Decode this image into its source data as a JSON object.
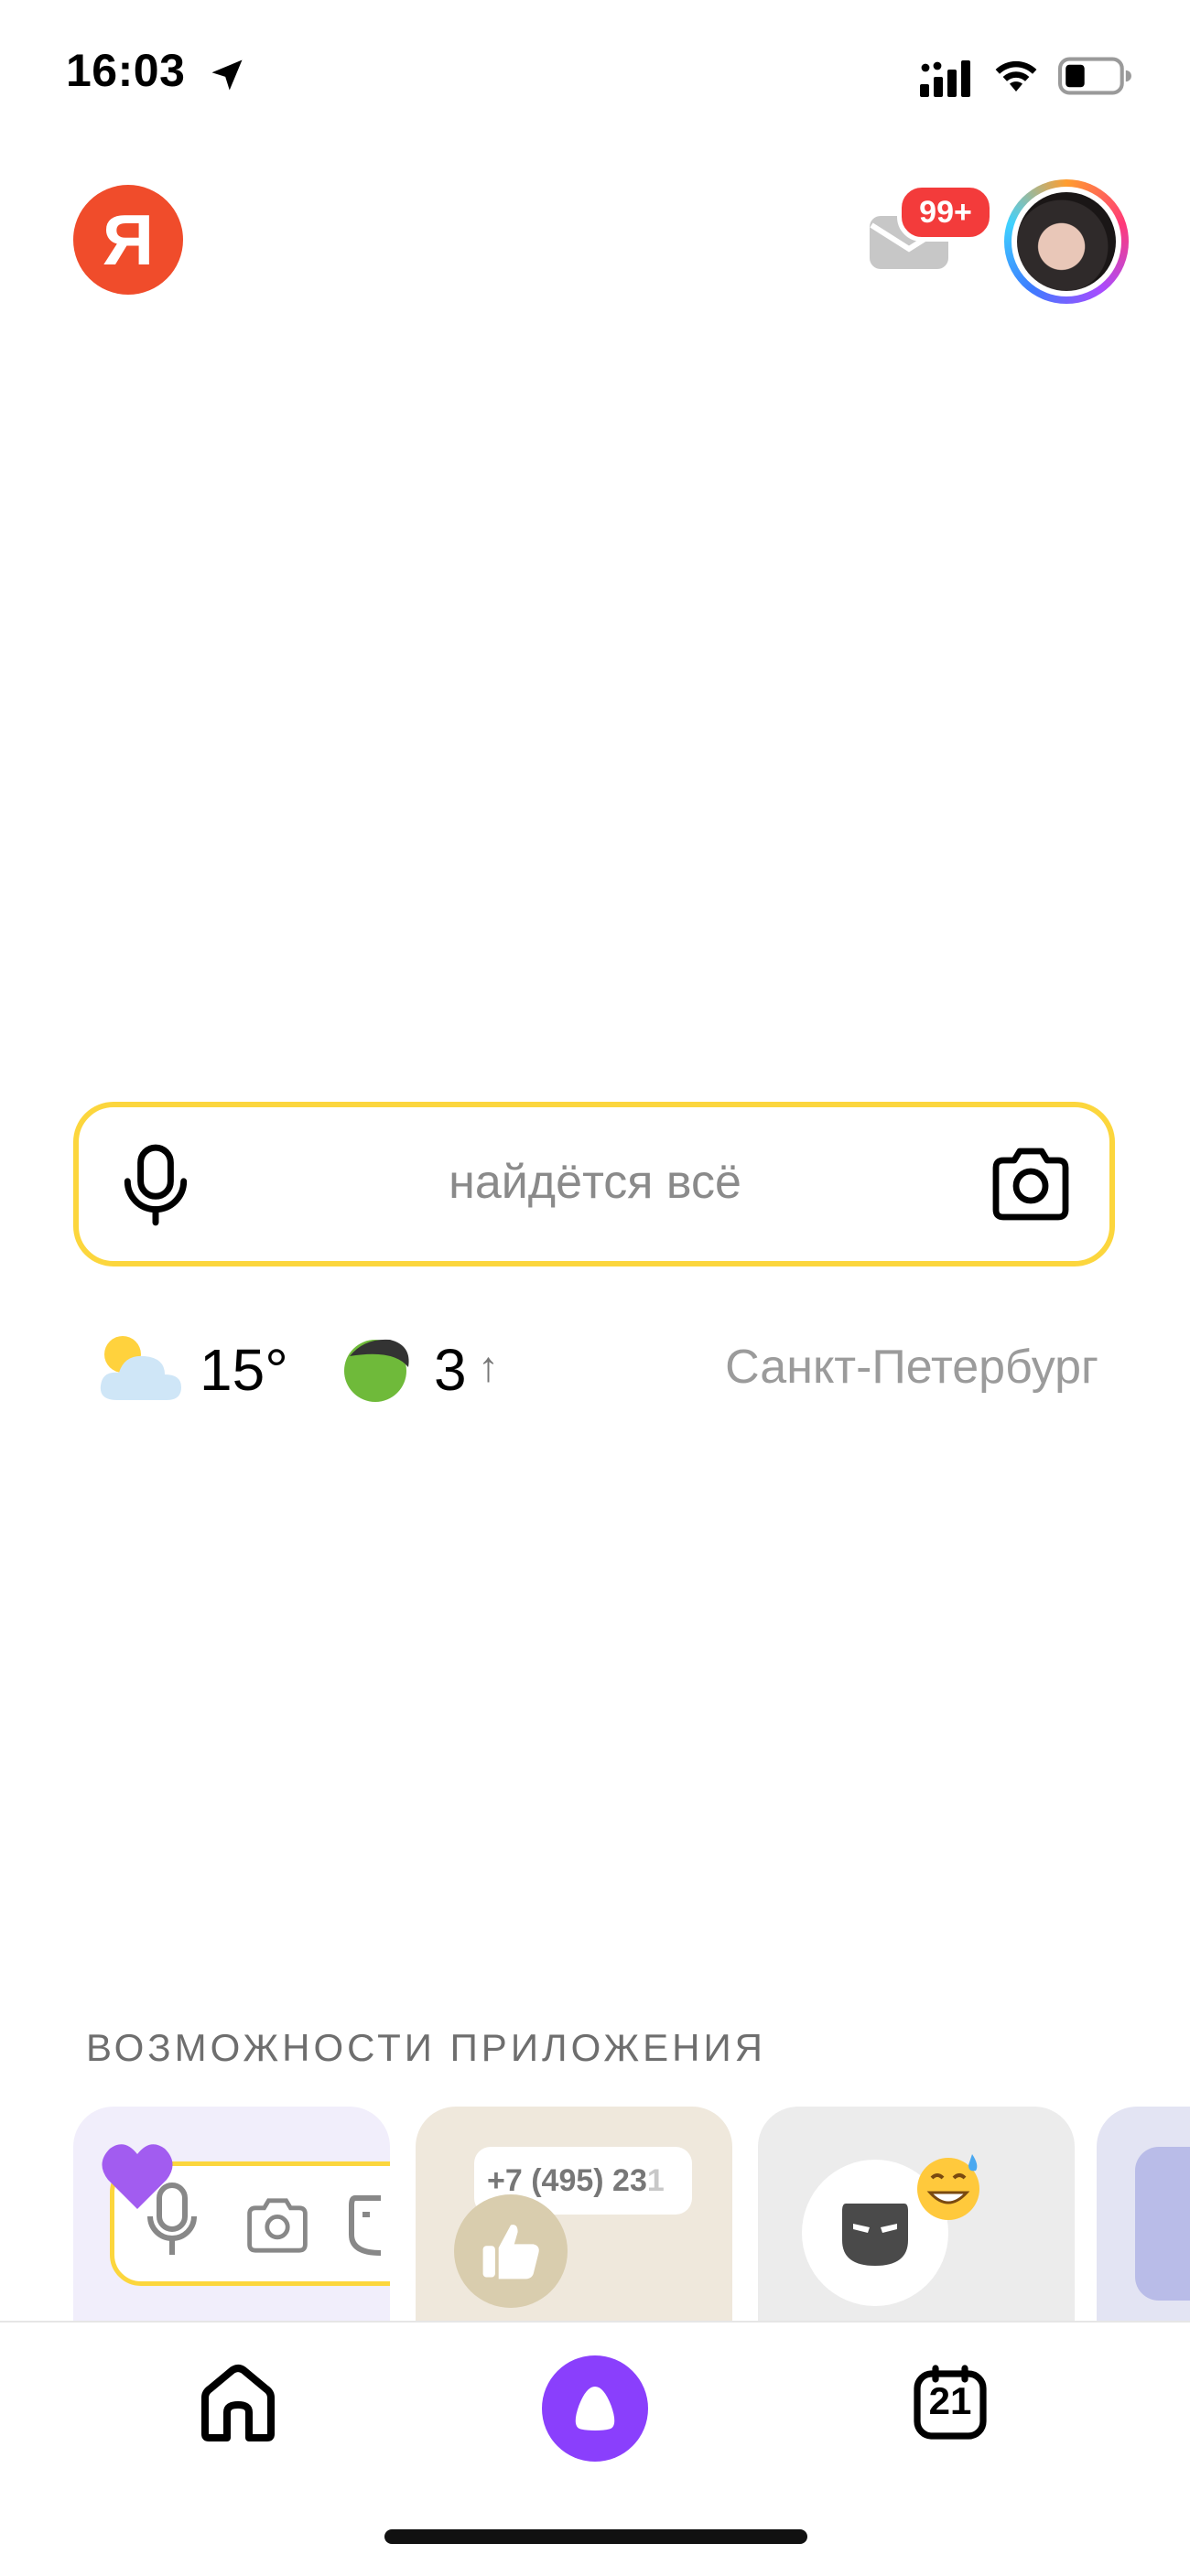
{
  "status_bar": {
    "time": "16:03"
  },
  "header": {
    "logo_letter": "Я",
    "mail_badge": "99+"
  },
  "search": {
    "placeholder": "найдётся всё"
  },
  "info_row": {
    "temperature": "15°",
    "traffic_level": "3",
    "traffic_trend": "↑",
    "city": "Санкт-Петербург"
  },
  "features": {
    "title": "ВОЗМОЖНОСТИ ПРИЛОЖЕНИЯ",
    "phone_prefix": "+7 (495) 23",
    "phone_faded": "1"
  },
  "bottom_nav": {
    "calendar_day": "21"
  },
  "colors": {
    "accent_yellow": "#fcd63d",
    "brand_red": "#f04c2b",
    "alice_purple": "#8a3ffc",
    "badge_red": "#f33b3b"
  },
  "icons": [
    "location-arrow-icon",
    "signal-icon",
    "wifi-icon",
    "battery-icon",
    "mail-icon",
    "mic-icon",
    "camera-icon",
    "weather-icon",
    "traffic-icon",
    "heart-icon",
    "thumbs-up-icon",
    "mask-icon",
    "emoji-icon",
    "keypad-icon",
    "home-icon",
    "alice-icon",
    "calendar-icon"
  ]
}
